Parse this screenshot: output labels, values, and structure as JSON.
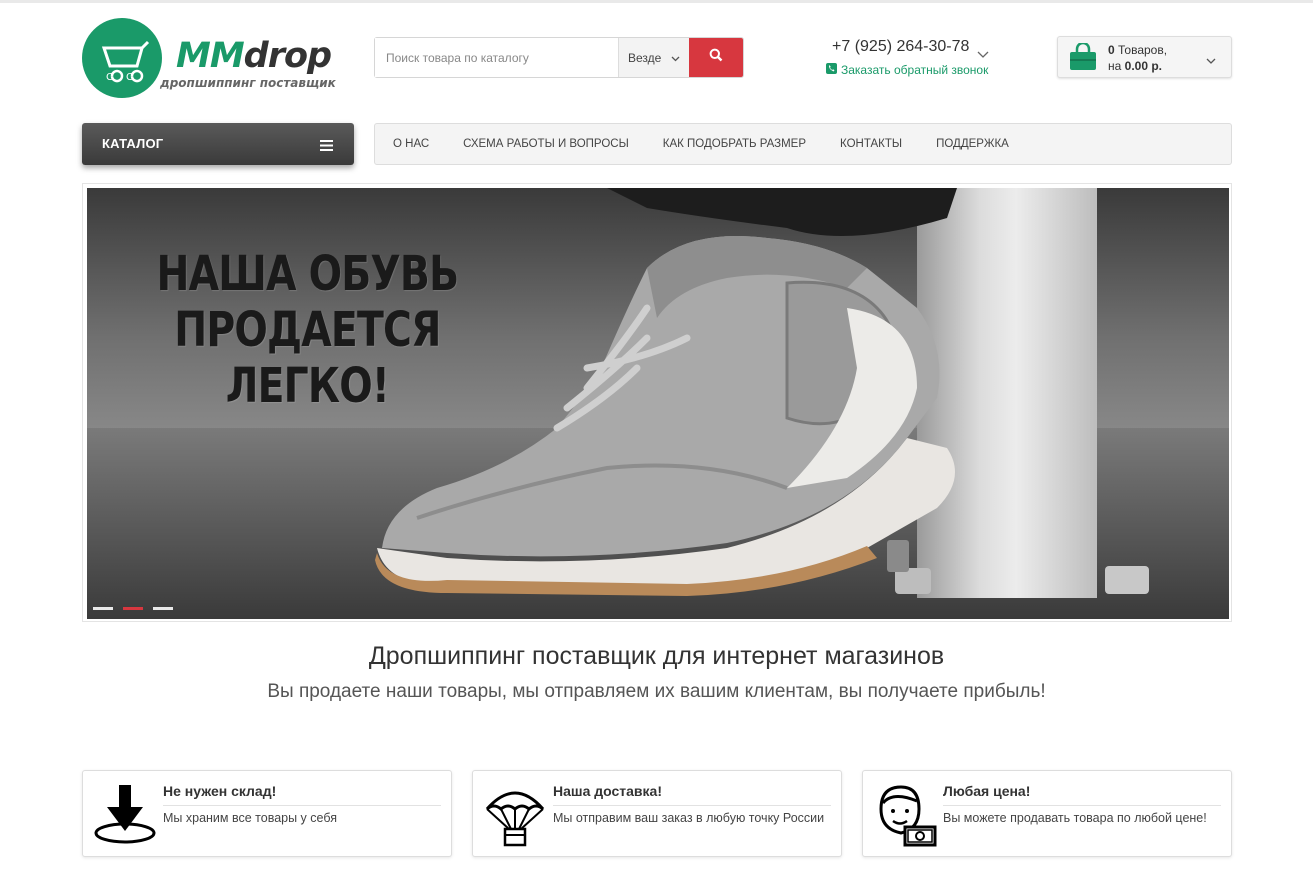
{
  "header": {
    "logo_main": "MM",
    "logo_rest": "drop",
    "logo_tagline": "дропшиппинг поставщик",
    "search": {
      "placeholder": "Поиск товара по каталогу",
      "scope": "Везде",
      "button_icon": "search-icon"
    },
    "phone": "+7 (925) 264-30-78",
    "callback": "Заказать обратный звонок",
    "cart": {
      "count_value": "0",
      "count_label": "Товаров,",
      "sum_prefix": "на",
      "sum_value": "0.00 р."
    }
  },
  "nav": {
    "catalog": "КАТАЛОГ",
    "items": [
      "О НАС",
      "СХЕМА РАБОТЫ И ВОПРОСЫ",
      "КАК ПОДОБРАТЬ РАЗМЕР",
      "КОНТАКТЫ",
      "ПОДДЕРЖКА"
    ]
  },
  "banner": {
    "title_line1": "НАША ОБУВЬ",
    "title_line2": "ПРОДАЕТСЯ ЛЕГКО!",
    "slides": 3,
    "active_slide": 2
  },
  "intro": {
    "headline": "Дропшиппинг поставщик для интернет магазинов",
    "subline": "Вы продаете наши товары, мы отправляем их вашим клиентам, вы получаете прибыль!"
  },
  "features": [
    {
      "icon": "download-arrow-icon",
      "title": "Не нужен склад!",
      "text": "Мы храним все товары у себя"
    },
    {
      "icon": "parachute-box-icon",
      "title": "Наша доставка!",
      "text": "Мы отправим ваш заказ в любую точку России"
    },
    {
      "icon": "person-money-icon",
      "title": "Любая цена!",
      "text": "Вы можете продавать товара по любой цене!"
    }
  ],
  "colors": {
    "brand_green": "#1a9a69",
    "accent_red": "#d7373f",
    "catalog_dark": "#444444"
  }
}
